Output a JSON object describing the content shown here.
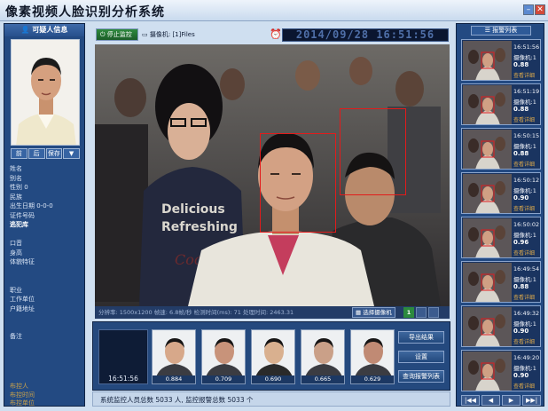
{
  "window": {
    "title": "像素视频人脸识别分析系统"
  },
  "left_panel": {
    "header": "可疑人信息",
    "nav": [
      "前",
      "后",
      "保存",
      "▼"
    ],
    "fields": [
      {
        "label": "姓名",
        "value": ""
      },
      {
        "label": "别名",
        "value": ""
      },
      {
        "label": "性别",
        "value": "0"
      },
      {
        "label": "民族",
        "value": ""
      },
      {
        "label": "出生日期",
        "value": "0-0-0"
      },
      {
        "label": "证件号码",
        "value": ""
      },
      {
        "label": "",
        "value": "逃犯库",
        "bold": true
      },
      {
        "label": "",
        "value": ""
      },
      {
        "label": "口音",
        "value": ""
      },
      {
        "label": "身高",
        "value": ""
      },
      {
        "label": "体貌特征",
        "value": ""
      },
      {
        "label": "",
        "value": ""
      },
      {
        "label": "",
        "value": ""
      },
      {
        "label": "职业",
        "value": ""
      },
      {
        "label": "工作单位",
        "value": ""
      },
      {
        "label": "户籍地址",
        "value": ""
      },
      {
        "label": "",
        "value": ""
      },
      {
        "label": "",
        "value": ""
      },
      {
        "label": "备注",
        "value": ""
      }
    ],
    "source": [
      "布控人",
      "布控时间",
      "布控单位"
    ]
  },
  "controls": {
    "stop_label": "停止监控",
    "camera_label": "摄像机: [1]Files",
    "timestamp": "2014/09/28 16:51:56"
  },
  "video_status": {
    "text": "分辨率: 1500x1200  帧速: 6.8帧/秒  检测时间(ms): 71  处理时间: 2463.31",
    "select_label": "选择摄像机",
    "grid_label": "1"
  },
  "capture_panel": {
    "time": "16:51:56",
    "scores": [
      "0.884",
      "0.709",
      "0.690",
      "0.665",
      "0.629"
    ],
    "buttons": [
      "导出结果",
      "设置",
      "查询报警列表"
    ]
  },
  "counts": {
    "text": "系统监控人员总数 5033 人, 监控报警总数 5033 个"
  },
  "right_panel": {
    "header": "报警列表",
    "alarms": [
      {
        "time": "16:51:56",
        "camera": "摄像机:1",
        "score": "0.88",
        "action": "查看详细"
      },
      {
        "time": "16:51:19",
        "camera": "摄像机:1",
        "score": "0.88",
        "action": "查看详细"
      },
      {
        "time": "16:50:15",
        "camera": "摄像机:1",
        "score": "0.88",
        "action": "查看详细"
      },
      {
        "time": "16:50:12",
        "camera": "摄像机:1",
        "score": "0.90",
        "action": "查看详细"
      },
      {
        "time": "16:50:02",
        "camera": "摄像机:1",
        "score": "0.96",
        "action": "查看详细"
      },
      {
        "time": "16:49:54",
        "camera": "摄像机:1",
        "score": "0.88",
        "action": "查看详细"
      },
      {
        "time": "16:49:32",
        "camera": "摄像机:1",
        "score": "0.90",
        "action": "查看详细"
      },
      {
        "time": "16:49:20",
        "camera": "摄像机:1",
        "score": "0.90",
        "action": "查看详细"
      }
    ],
    "pager": [
      "|◀◀",
      "◀",
      "▶",
      "▶▶|"
    ]
  },
  "colors": {
    "panel": "#234a82",
    "alarm_box": "#e21b1b",
    "accent_gold": "#dca94b"
  }
}
